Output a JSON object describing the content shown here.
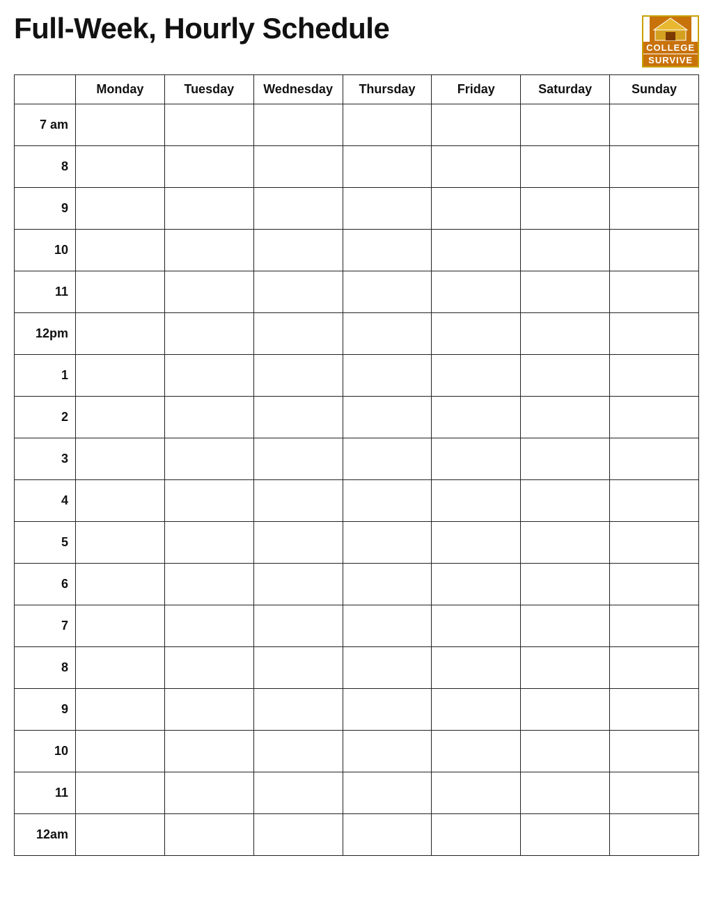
{
  "header": {
    "title": "Full-Week, Hourly Schedule",
    "logo": {
      "college": "COLLEGE",
      "survive": "SURVIVE"
    }
  },
  "table": {
    "days": [
      "Monday",
      "Tuesday",
      "Wednesday",
      "Thursday",
      "Friday",
      "Saturday",
      "Sunday"
    ],
    "times": [
      "7 am",
      "8",
      "9",
      "10",
      "11",
      "12pm",
      "1",
      "2",
      "3",
      "4",
      "5",
      "6",
      "7",
      "8",
      "9",
      "10",
      "11",
      "12am"
    ]
  }
}
